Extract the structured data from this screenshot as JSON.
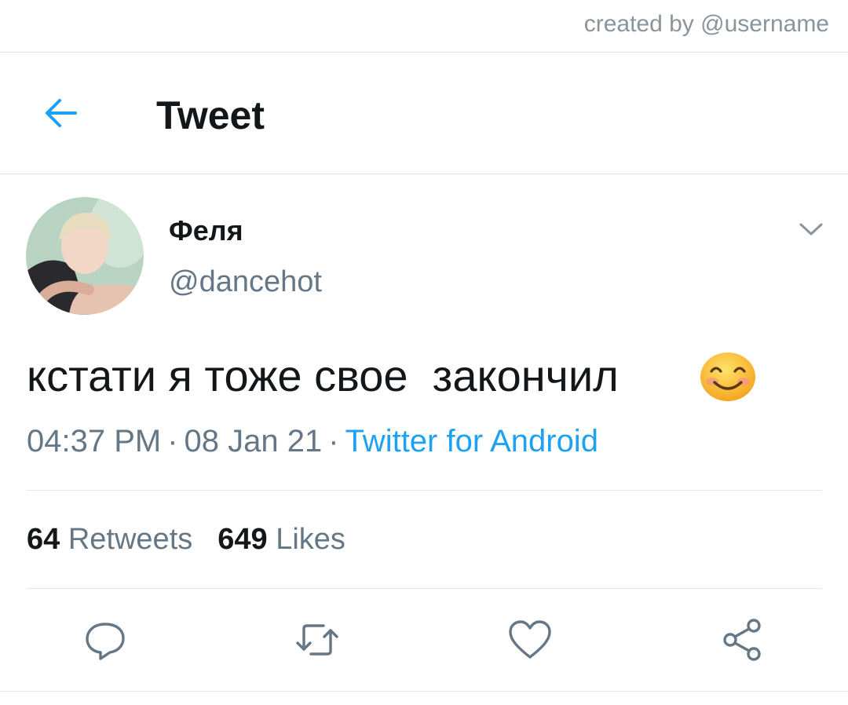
{
  "watermark": "created by @username",
  "header": {
    "title": "Tweet",
    "back_icon": "arrow-left-icon"
  },
  "tweet": {
    "author": {
      "display_name": "Феля",
      "handle": "@dancehot"
    },
    "text": "кстати я тоже свое  закончил",
    "emoji": "smiling-face-with-smiling-eyes",
    "time": "04:37 PM",
    "date": "08 Jan 21",
    "separator": "·",
    "source": "Twitter for Android"
  },
  "stats": {
    "retweets": {
      "count": "64",
      "label": "Retweets"
    },
    "likes": {
      "count": "649",
      "label": "Likes"
    }
  },
  "actions": [
    "reply-icon",
    "retweet-icon",
    "like-icon",
    "share-icon"
  ],
  "colors": {
    "accent": "#1da1f2",
    "text_primary": "#14171a",
    "text_secondary": "#657786",
    "icon_gray": "#657786",
    "divider": "#e1e6ea"
  }
}
